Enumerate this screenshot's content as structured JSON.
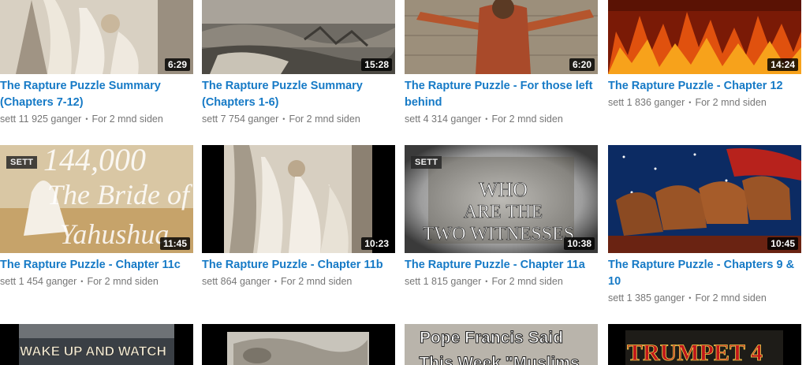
{
  "videos": [
    {
      "title": "The Rapture Puzzle Summary (Chapters 7-12)",
      "duration": "6:29",
      "views": "sett 11 925 ganger",
      "age": "For 2 mnd siden",
      "seen_badge": ""
    },
    {
      "title": "The Rapture Puzzle Summary (Chapters 1-6)",
      "duration": "15:28",
      "views": "sett 7 754 ganger",
      "age": "For 2 mnd siden",
      "seen_badge": ""
    },
    {
      "title": "The Rapture Puzzle - For those left behind",
      "duration": "6:20",
      "views": "sett 4 314 ganger",
      "age": "For 2 mnd siden",
      "seen_badge": ""
    },
    {
      "title": "The Rapture Puzzle - Chapter 12",
      "duration": "14:24",
      "views": "sett 1 836 ganger",
      "age": "For 2 mnd siden",
      "seen_badge": ""
    },
    {
      "title": "The Rapture Puzzle - Chapter 11c",
      "duration": "11:45",
      "views": "sett 1 454 ganger",
      "age": "For 2 mnd siden",
      "seen_badge": "SETT",
      "thumb_text": [
        "144,000",
        "The Bride of",
        "Yahushua"
      ]
    },
    {
      "title": "The Rapture Puzzle - Chapter 11b",
      "duration": "10:23",
      "views": "sett 864 ganger",
      "age": "For 2 mnd siden",
      "seen_badge": ""
    },
    {
      "title": "The Rapture Puzzle - Chapter 11a",
      "duration": "10:38",
      "views": "sett 1 815 ganger",
      "age": "For 2 mnd siden",
      "seen_badge": "SETT",
      "thumb_text": [
        "WHO",
        "ARE THE",
        "TWO WITNESSES"
      ]
    },
    {
      "title": "The Rapture Puzzle - Chapters 9 & 10",
      "duration": "10:45",
      "views": "sett 1 385 ganger",
      "age": "For 2 mnd siden",
      "seen_badge": ""
    },
    {
      "title": "",
      "duration": "",
      "views": "",
      "age": "",
      "seen_badge": "",
      "thumb_text": [
        "WAKE UP AND WATCH"
      ]
    },
    {
      "title": "",
      "duration": "",
      "views": "",
      "age": "",
      "seen_badge": ""
    },
    {
      "title": "",
      "duration": "",
      "views": "",
      "age": "",
      "seen_badge": "",
      "thumb_text": [
        "Pope Francis Said",
        "This Week \"Muslims"
      ]
    },
    {
      "title": "",
      "duration": "",
      "views": "",
      "age": "",
      "seen_badge": "",
      "thumb_text": [
        "TRUMPET 4"
      ]
    }
  ]
}
